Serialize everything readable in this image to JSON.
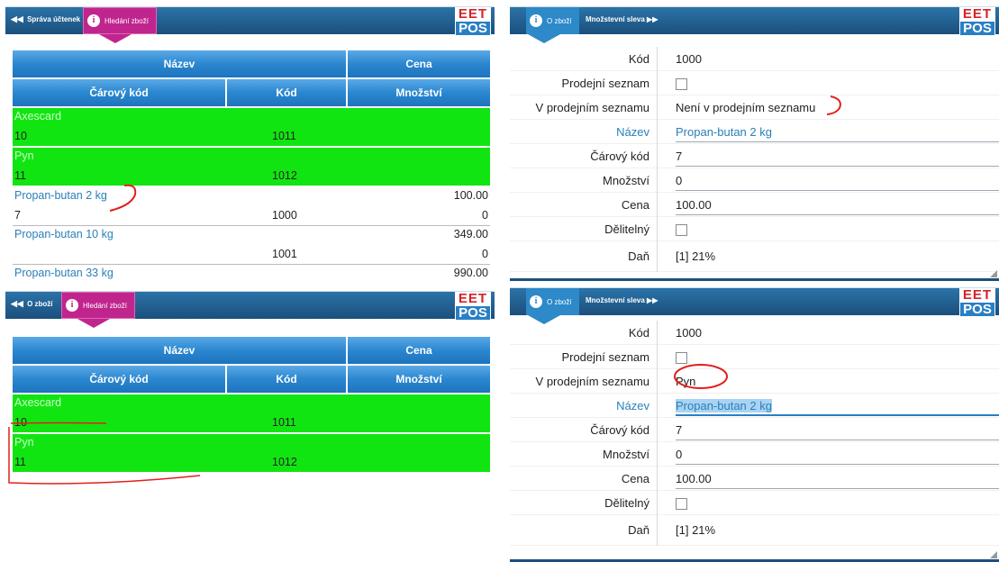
{
  "logo": {
    "eet": "EET",
    "pos": "POS"
  },
  "panel1": {
    "back_label": "Správa účtenek",
    "tab_label": "Hledání zboží",
    "header_row1": [
      "Název",
      "Cena"
    ],
    "header_row2": [
      "Čárový kód",
      "Kód",
      "Množství"
    ],
    "items": [
      {
        "name": "Axescard",
        "price": "",
        "barcode": "10",
        "code": "1011",
        "qty": "",
        "highlight": true
      },
      {
        "name": "Pyn",
        "price": "",
        "barcode": "11",
        "code": "1012",
        "qty": "",
        "highlight": true
      },
      {
        "name": "Propan-butan 2 kg",
        "price": "100.00",
        "barcode": "7",
        "code": "1000",
        "qty": "0",
        "highlight": false
      },
      {
        "name": "Propan-butan 10 kg",
        "price": "349.00",
        "barcode": "",
        "code": "1001",
        "qty": "0",
        "highlight": false
      },
      {
        "name": "Propan-butan 33 kg",
        "price": "990.00",
        "barcode": "",
        "code": "",
        "qty": "",
        "highlight": false
      }
    ]
  },
  "panel2": {
    "tab_label": "O zboží",
    "next_label": "Množstevní sleva",
    "fields": {
      "kod": {
        "label": "Kód",
        "value": "1000"
      },
      "prodejni_seznam": {
        "label": "Prodejní seznam"
      },
      "v_prodejnim": {
        "label": "V prodejním seznamu",
        "value": "Není v prodejním seznamu"
      },
      "nazev": {
        "label": "Název",
        "value": "Propan-butan 2 kg"
      },
      "carovy": {
        "label": "Čárový kód",
        "value": "7"
      },
      "mnozstvi": {
        "label": "Množství",
        "value": "0"
      },
      "cena": {
        "label": "Cena",
        "value": "100.00"
      },
      "delitelny": {
        "label": "Dělitelný"
      },
      "dan": {
        "label": "Daň",
        "value": "[1] 21%"
      }
    }
  },
  "panel3": {
    "back_label": "O zboží",
    "tab_label": "Hledání zboží",
    "header_row1": [
      "Název",
      "Cena"
    ],
    "header_row2": [
      "Čárový kód",
      "Kód",
      "Množství"
    ],
    "items": [
      {
        "name": "Axescard",
        "barcode": "10",
        "code": "1011"
      },
      {
        "name": "Pyn",
        "barcode": "11",
        "code": "1012"
      }
    ]
  },
  "panel4": {
    "tab_label": "O zboží",
    "next_label": "Množstevní sleva",
    "fields": {
      "kod": {
        "label": "Kód",
        "value": "1000"
      },
      "prodejni_seznam": {
        "label": "Prodejní seznam"
      },
      "v_prodejnim": {
        "label": "V prodejním seznamu",
        "value": "Pyn"
      },
      "nazev": {
        "label": "Název",
        "value": "Propan-butan 2 kg"
      },
      "carovy": {
        "label": "Čárový kód",
        "value": "7"
      },
      "mnozstvi": {
        "label": "Množství",
        "value": "0"
      },
      "cena": {
        "label": "Cena",
        "value": "100.00"
      },
      "delitelny": {
        "label": "Dělitelný"
      },
      "dan": {
        "label": "Daň",
        "value": "[1] 21%"
      }
    }
  },
  "colors": {
    "header_blue": "#1b4f7c",
    "tab_pink": "#c0258e",
    "highlight_green": "#11e511",
    "link_blue": "#2a7fb8",
    "annotation_red": "#e0201c"
  }
}
